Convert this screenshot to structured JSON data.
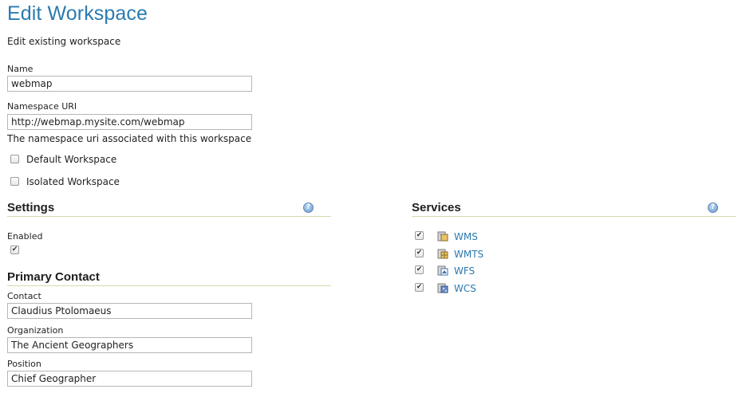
{
  "page": {
    "title": "Edit Workspace",
    "subtitle": "Edit existing workspace"
  },
  "form": {
    "name_label": "Name",
    "name_value": "webmap",
    "uri_label": "Namespace URI",
    "uri_value": "http://webmap.mysite.com/webmap",
    "uri_hint": "The namespace uri associated with this workspace",
    "default_workspace_label": "Default Workspace",
    "default_workspace_checked": false,
    "isolated_workspace_label": "Isolated Workspace",
    "isolated_workspace_checked": false
  },
  "settings": {
    "title": "Settings",
    "help_glyph": "?",
    "enabled_label": "Enabled",
    "enabled_checked": true
  },
  "primary_contact": {
    "title": "Primary Contact",
    "contact_label": "Contact",
    "contact_value": "Claudius Ptolomaeus",
    "organization_label": "Organization",
    "organization_value": "The Ancient Geographers",
    "position_label": "Position",
    "position_value": "Chief Geographer"
  },
  "services": {
    "title": "Services",
    "help_glyph": "?",
    "items": [
      {
        "label": "WMS",
        "checked": true,
        "icon": "wms-icon"
      },
      {
        "label": "WMTS",
        "checked": true,
        "icon": "wmts-icon"
      },
      {
        "label": "WFS",
        "checked": true,
        "icon": "wfs-icon"
      },
      {
        "label": "WCS",
        "checked": true,
        "icon": "wcs-icon"
      }
    ]
  },
  "colors": {
    "title": "#2b7bb0",
    "link": "#2b7bb0",
    "section_rule": "#cfdcae",
    "input_border": "#b6b6b6"
  }
}
